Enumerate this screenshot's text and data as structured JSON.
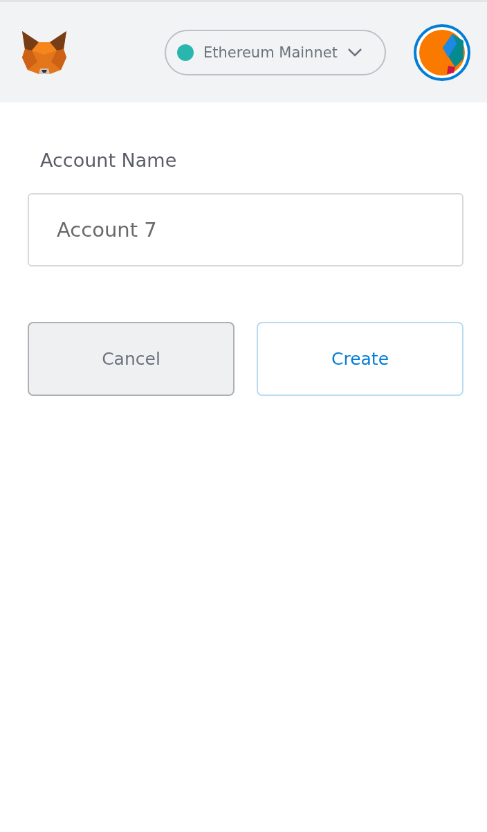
{
  "header": {
    "network": {
      "name": "Ethereum Mainnet"
    }
  },
  "form": {
    "label": "Account Name",
    "value": "Account 7"
  },
  "buttons": [
    {
      "label": "Cancel",
      "kind": "secondary"
    },
    {
      "label": "Create",
      "kind": "primary"
    }
  ]
}
